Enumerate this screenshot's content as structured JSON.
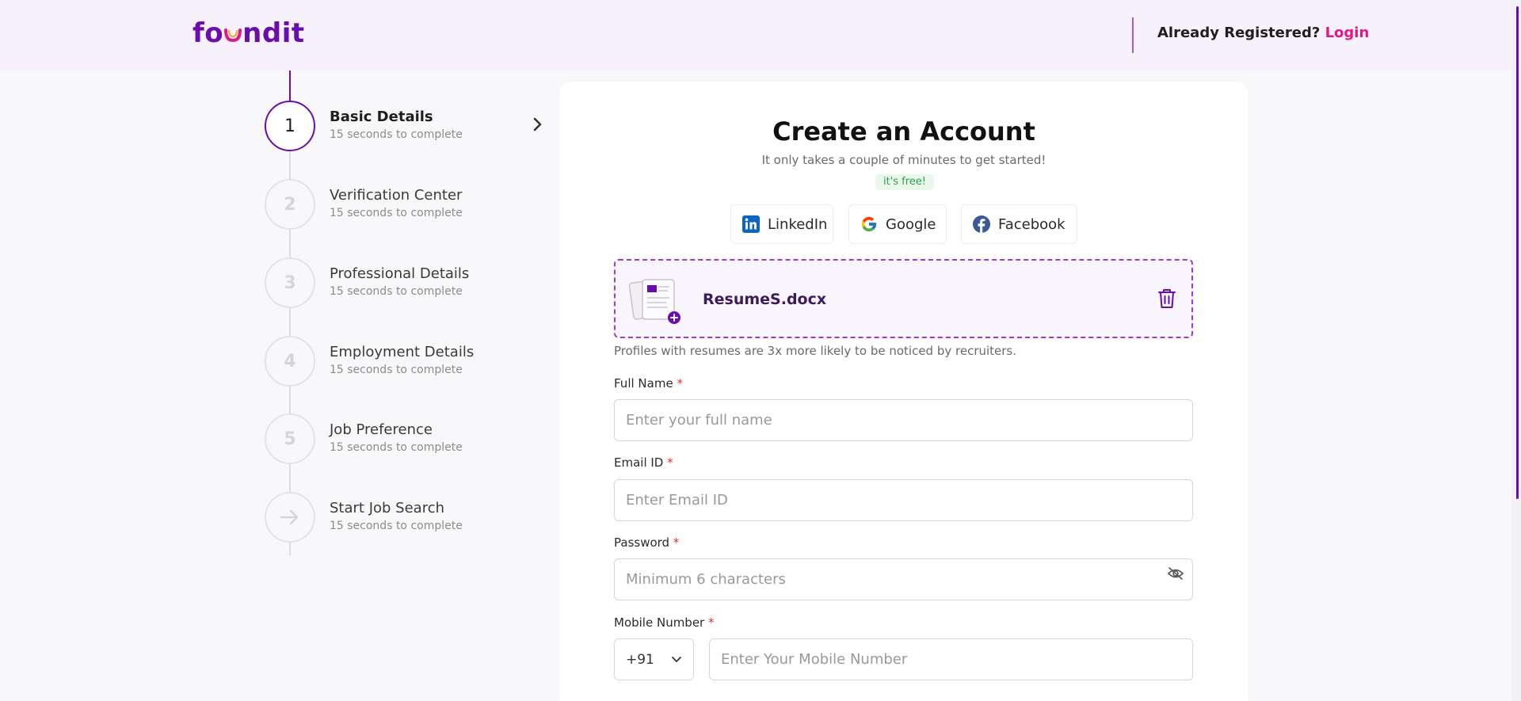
{
  "header": {
    "logo_prefix": "fo",
    "logo_suffix": "ndit",
    "already_registered": "Already Registered?",
    "login_label": "Login"
  },
  "stepper": {
    "steps": [
      {
        "number": "1",
        "title": "Basic Details",
        "subtitle": "15 seconds to complete"
      },
      {
        "number": "2",
        "title": "Verification Center",
        "subtitle": "15 seconds to complete"
      },
      {
        "number": "3",
        "title": "Professional Details",
        "subtitle": "15 seconds to complete"
      },
      {
        "number": "4",
        "title": "Employment Details",
        "subtitle": "15 seconds to complete"
      },
      {
        "number": "5",
        "title": "Job Preference",
        "subtitle": "15 seconds to complete"
      },
      {
        "number": "",
        "title": "Start Job Search",
        "subtitle": "15 seconds to complete",
        "icon": "arrow-right-icon"
      }
    ],
    "active_step": 1
  },
  "form": {
    "title": "Create an Account",
    "subtitle": "It only takes a couple of minutes to get started!",
    "free_badge": "it's free!",
    "social": {
      "linkedin": "LinkedIn",
      "google": "Google",
      "facebook": "Facebook"
    },
    "resume": {
      "filename": "ResumeS.docx",
      "hint": "Profiles with resumes are 3x more likely to be noticed by recruiters."
    },
    "full_name": {
      "label": "Full Name",
      "required": "*",
      "placeholder": "Enter your full name",
      "value": ""
    },
    "email": {
      "label": "Email ID",
      "required": "*",
      "placeholder": "Enter Email ID",
      "value": ""
    },
    "password": {
      "label": "Password",
      "required": "*",
      "placeholder": "Minimum 6 characters",
      "value": ""
    },
    "mobile": {
      "label": "Mobile Number",
      "required": "*",
      "country_code": "+91",
      "placeholder": "Enter Your Mobile Number",
      "value": ""
    }
  },
  "colors": {
    "brand": "#6a0dad",
    "accent": "#e0198a",
    "dashed_border": "#a438c9",
    "free_green": "#2fa04a"
  }
}
